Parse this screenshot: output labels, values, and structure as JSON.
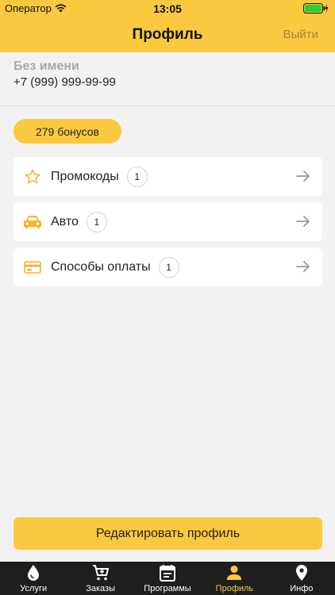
{
  "status_bar": {
    "carrier": "Оператор",
    "time": "13:05"
  },
  "header": {
    "title": "Профиль",
    "logout_label": "Выйти"
  },
  "user": {
    "name": "Без имени",
    "phone": "+7 (999) 999-99-99"
  },
  "bonus": {
    "label": "279 бонусов"
  },
  "menu": [
    {
      "label": "Промокоды",
      "count": "1",
      "icon": "star-icon"
    },
    {
      "label": "Авто",
      "count": "1",
      "icon": "car-icon"
    },
    {
      "label": "Способы оплаты",
      "count": "1",
      "icon": "card-icon"
    }
  ],
  "edit_button": {
    "label": "Редактировать профиль"
  },
  "tabs": [
    {
      "label": "Услуги",
      "icon": "drop-icon",
      "active": false
    },
    {
      "label": "Заказы",
      "icon": "cart-icon",
      "active": false
    },
    {
      "label": "Программы",
      "icon": "calendar-icon",
      "active": false
    },
    {
      "label": "Профиль",
      "icon": "person-icon",
      "active": true
    },
    {
      "label": "Инфо",
      "icon": "location-pin-icon",
      "active": false
    }
  ],
  "colors": {
    "accent": "#fbc93f",
    "tabbar": "#1e1e1e",
    "background": "#f2f2f2"
  }
}
